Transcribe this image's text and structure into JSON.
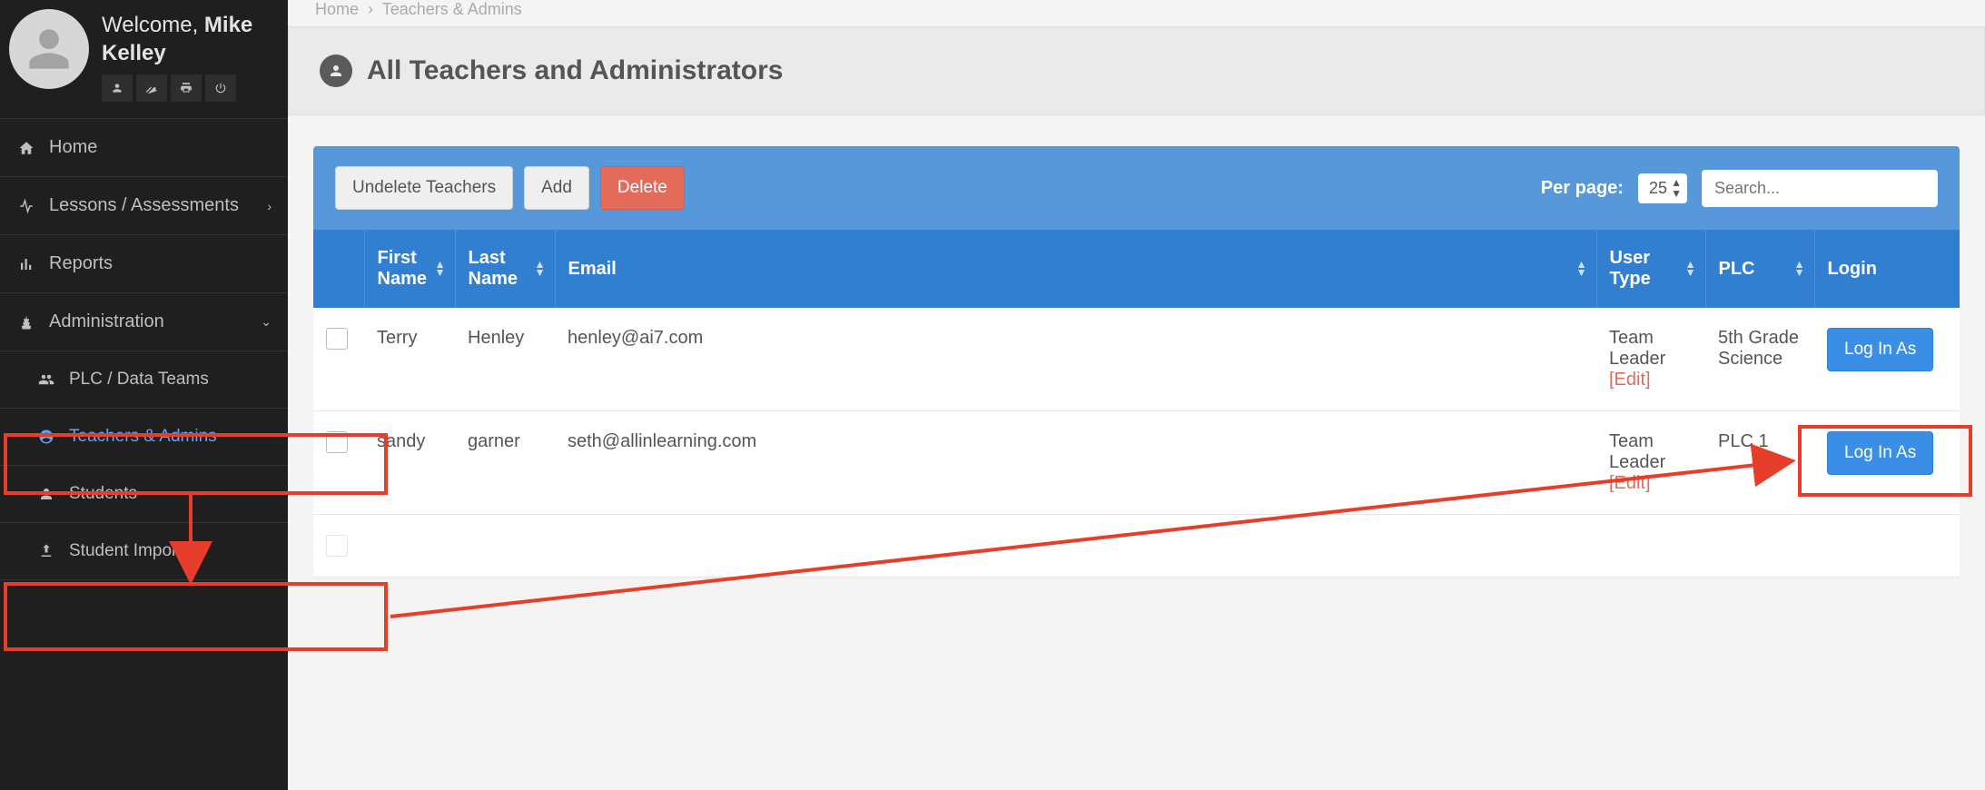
{
  "user": {
    "welcome_prefix": "Welcome, ",
    "first_name": "Mike",
    "last_name": "Kelley"
  },
  "breadcrumb": {
    "home": "Home",
    "current": "Teachers & Admins"
  },
  "sidebar": {
    "items": [
      {
        "label": "Home"
      },
      {
        "label": "Lessons / Assessments"
      },
      {
        "label": "Reports"
      },
      {
        "label": "Administration"
      }
    ],
    "admin_sub": [
      {
        "label": "PLC / Data Teams"
      },
      {
        "label": "Teachers & Admins"
      },
      {
        "label": "Students"
      },
      {
        "label": "Student Import"
      }
    ]
  },
  "page": {
    "title": "All Teachers and Administrators"
  },
  "toolbar": {
    "undelete": "Undelete Teachers",
    "add": "Add",
    "delete": "Delete",
    "per_page_label": "Per page:",
    "per_page_value": "25",
    "search_placeholder": "Search..."
  },
  "columns": {
    "first": "First Name",
    "last": "Last Name",
    "email": "Email",
    "usertype": "User Type",
    "plc": "PLC",
    "login": "Login"
  },
  "edit_label": "[Edit]",
  "login_as_label": "Log In As",
  "rows": [
    {
      "first": "Terry",
      "last": "Henley",
      "email": "henley@ai7.com",
      "usertype": "Team Leader",
      "plc": "5th Grade Science"
    },
    {
      "first": "sandy",
      "last": "garner",
      "email": "seth@allinlearning.com",
      "usertype": "Team Leader",
      "plc": "PLC 1"
    }
  ]
}
